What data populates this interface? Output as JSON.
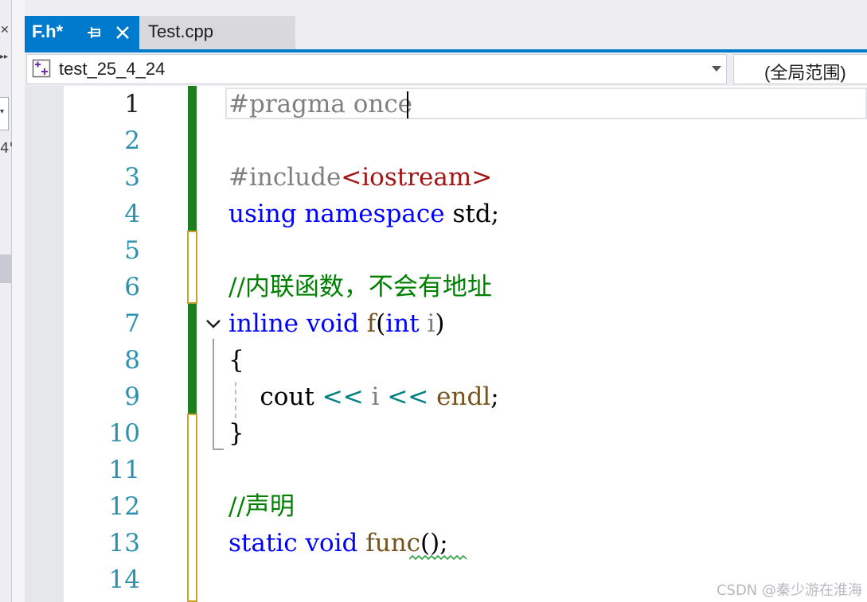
{
  "left_panel": {
    "fragments": [
      "✕",
      "▸▸",
      "▾",
      "4'"
    ]
  },
  "tabs": [
    {
      "label": "F.h*",
      "active": true
    },
    {
      "label": "Test.cpp",
      "active": false
    }
  ],
  "navigation": {
    "project_scope": "test_25_4_24",
    "member_scope": "(全局范围)"
  },
  "editor": {
    "line_numbers": [
      "1",
      "2",
      "3",
      "4",
      "5",
      "6",
      "7",
      "8",
      "9",
      "10",
      "11",
      "12",
      "13",
      "14"
    ],
    "lines": {
      "l1_directive": "#pragma once",
      "l3_directive": "#include",
      "l3_header": "<iostream>",
      "l4_using": "using",
      "l4_namespace": "namespace",
      "l4_std": "std;",
      "l6_comment": "//内联函数，不会有地址",
      "l7_inline": "inline",
      "l7_void": "void",
      "l7_fname": "f",
      "l7_open": "(",
      "l7_int": "int",
      "l7_param": "i",
      "l7_close": ")",
      "l8_brace": "{",
      "l9_cout": "cout",
      "l9_op1": "<<",
      "l9_i": "i",
      "l9_op2": "<<",
      "l9_endl": "endl",
      "l9_semi": ";",
      "l10_brace": "}",
      "l12_comment": "//声明",
      "l13_static": "static",
      "l13_void": "void",
      "l13_func": "func",
      "l13_rest": "();"
    }
  },
  "watermark": "CSDN @秦少游在淮海",
  "colors": {
    "accent": "#007acc",
    "keyword": "#0000ff",
    "comment": "#008000",
    "include_header": "#a31515",
    "function": "#74531f",
    "change_saved": "#1e7f1e",
    "change_unsaved": "#c9a227"
  }
}
